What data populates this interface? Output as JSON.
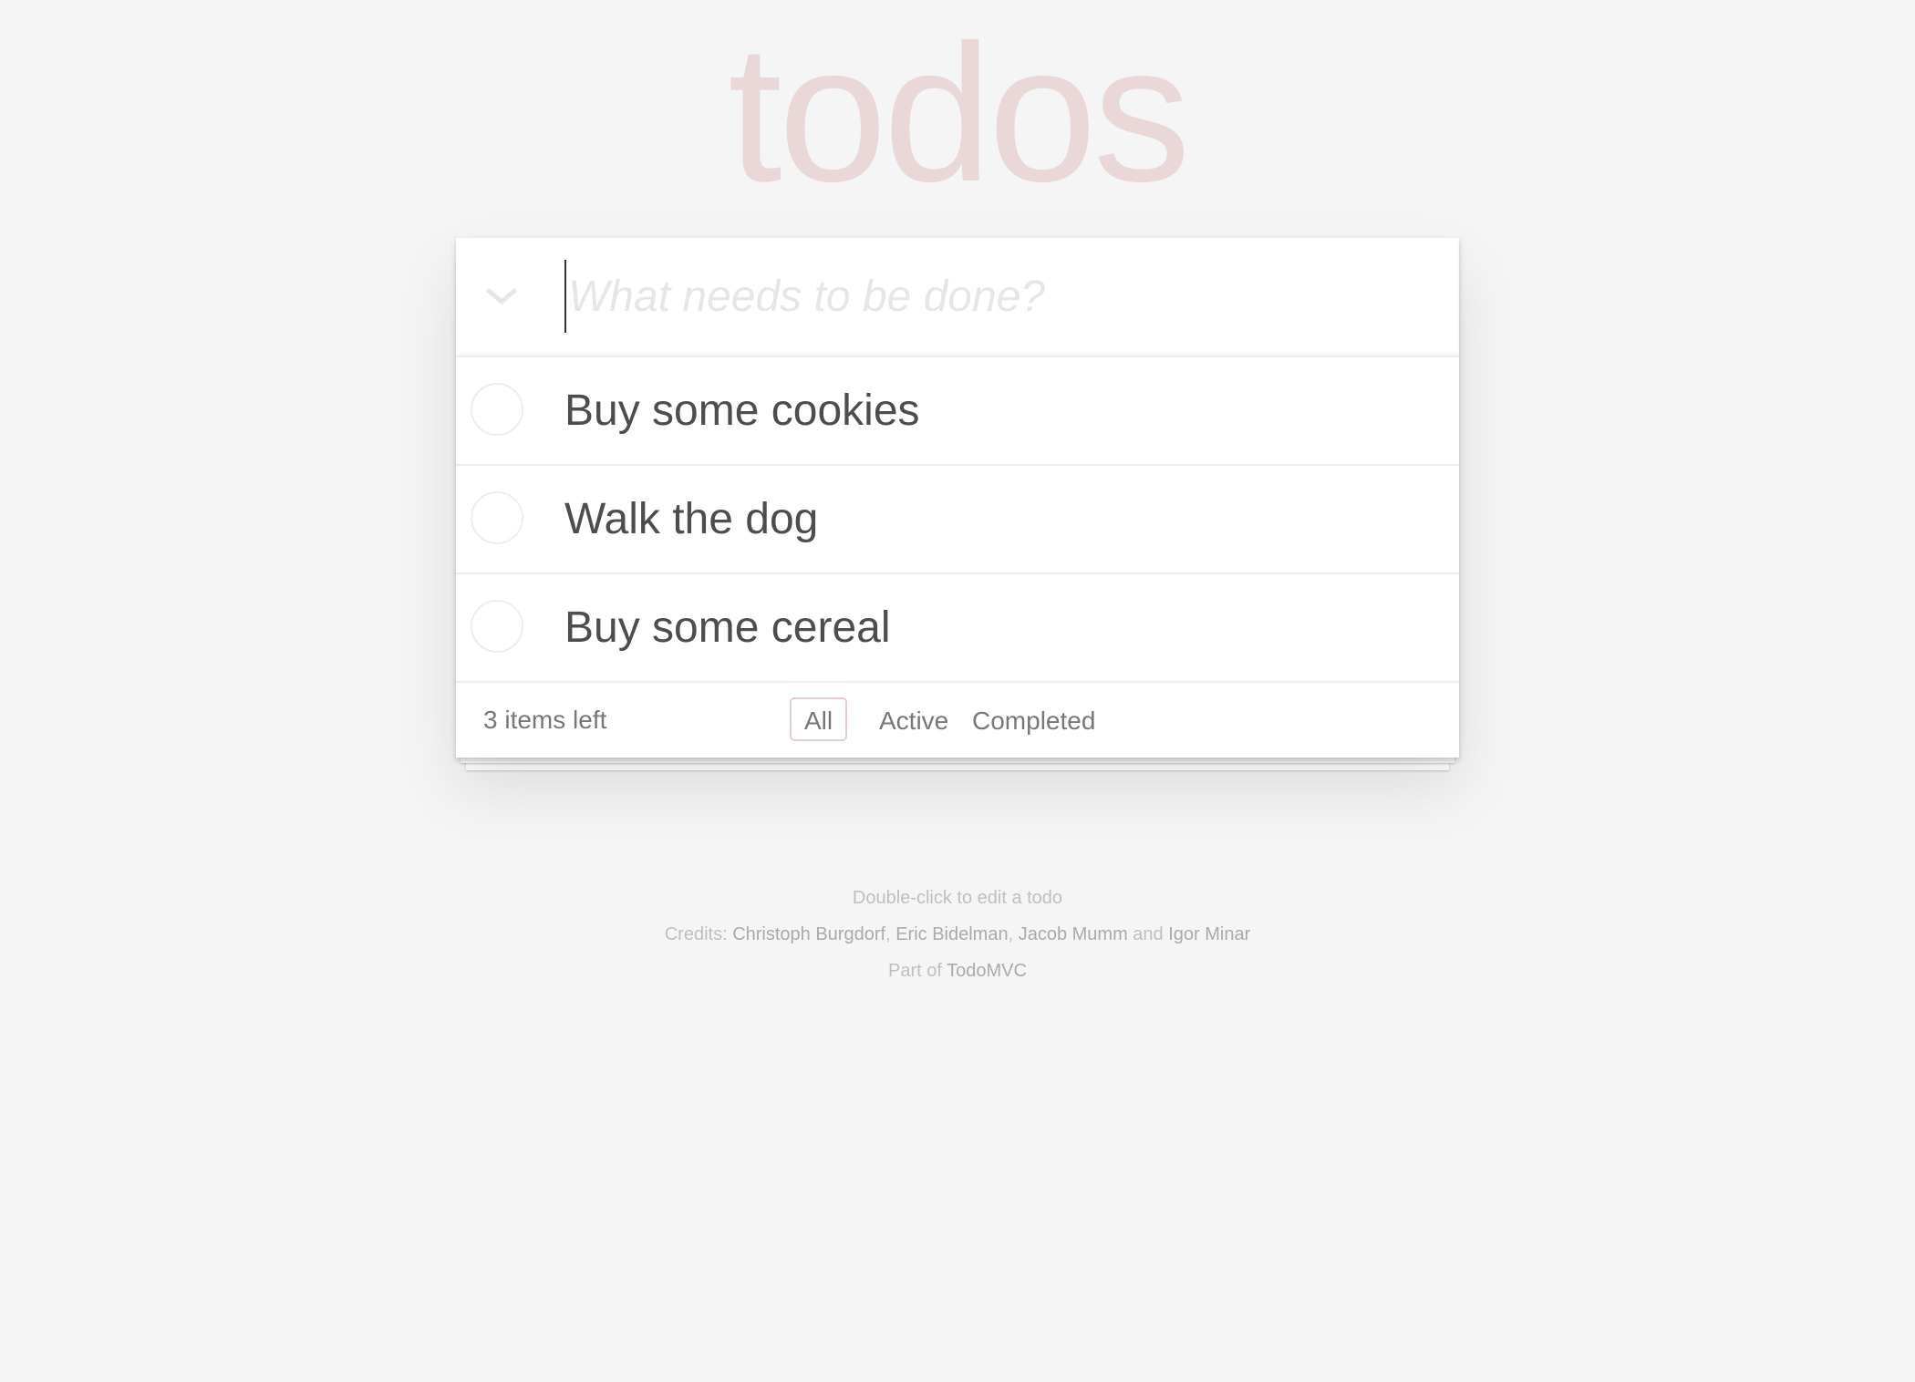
{
  "header": {
    "title": "todos"
  },
  "new_todo": {
    "placeholder": "What needs to be done?",
    "value": ""
  },
  "icons": {
    "toggle_all": "chevron-down-icon"
  },
  "todos": [
    {
      "label": "Buy some cookies",
      "completed": false
    },
    {
      "label": "Walk the dog",
      "completed": false
    },
    {
      "label": "Buy some cereal",
      "completed": false
    }
  ],
  "footer": {
    "count_text": "3 items left",
    "filters": [
      {
        "label": "All",
        "selected": true
      },
      {
        "label": "Active",
        "selected": false
      },
      {
        "label": "Completed",
        "selected": false
      }
    ]
  },
  "info": {
    "hint": "Double-click to edit a todo",
    "credits_prefix": "Credits:",
    "credit_1": "Christoph Burgdorf",
    "credit_2": "Eric Bidelman",
    "credit_3": "Jacob Mumm",
    "credit_and": "and",
    "credit_4": "Igor Minar",
    "part_of_prefix": "Part of",
    "part_of_link": "TodoMVC"
  },
  "colors": {
    "title": "#ead7d7",
    "background": "#f5f5f5",
    "selected_filter_border": "#e8c9c9"
  }
}
